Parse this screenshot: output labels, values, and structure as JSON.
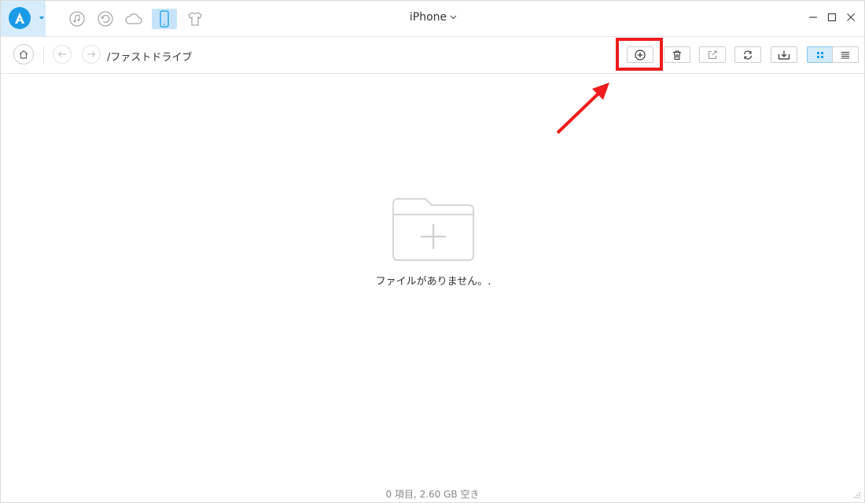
{
  "window": {
    "title": "iPhone"
  },
  "nav_icons": [
    "music-icon",
    "restore-icon",
    "cloud-icon",
    "phone-icon",
    "tshirt-icon"
  ],
  "toolbar": {
    "path": "/ファストドライブ",
    "buttons": [
      "add-icon",
      "trash-icon",
      "export-icon",
      "refresh-icon",
      "import-icon",
      "grid-view-icon",
      "list-view-icon"
    ]
  },
  "empty_state": {
    "message": "ファイルがありません。."
  },
  "status": {
    "text": "0 項目, 2.60 GB 空き"
  },
  "colors": {
    "brand": "#1b9be6",
    "active_bg": "#c6e4f9",
    "highlight": "#ee1c1c"
  }
}
